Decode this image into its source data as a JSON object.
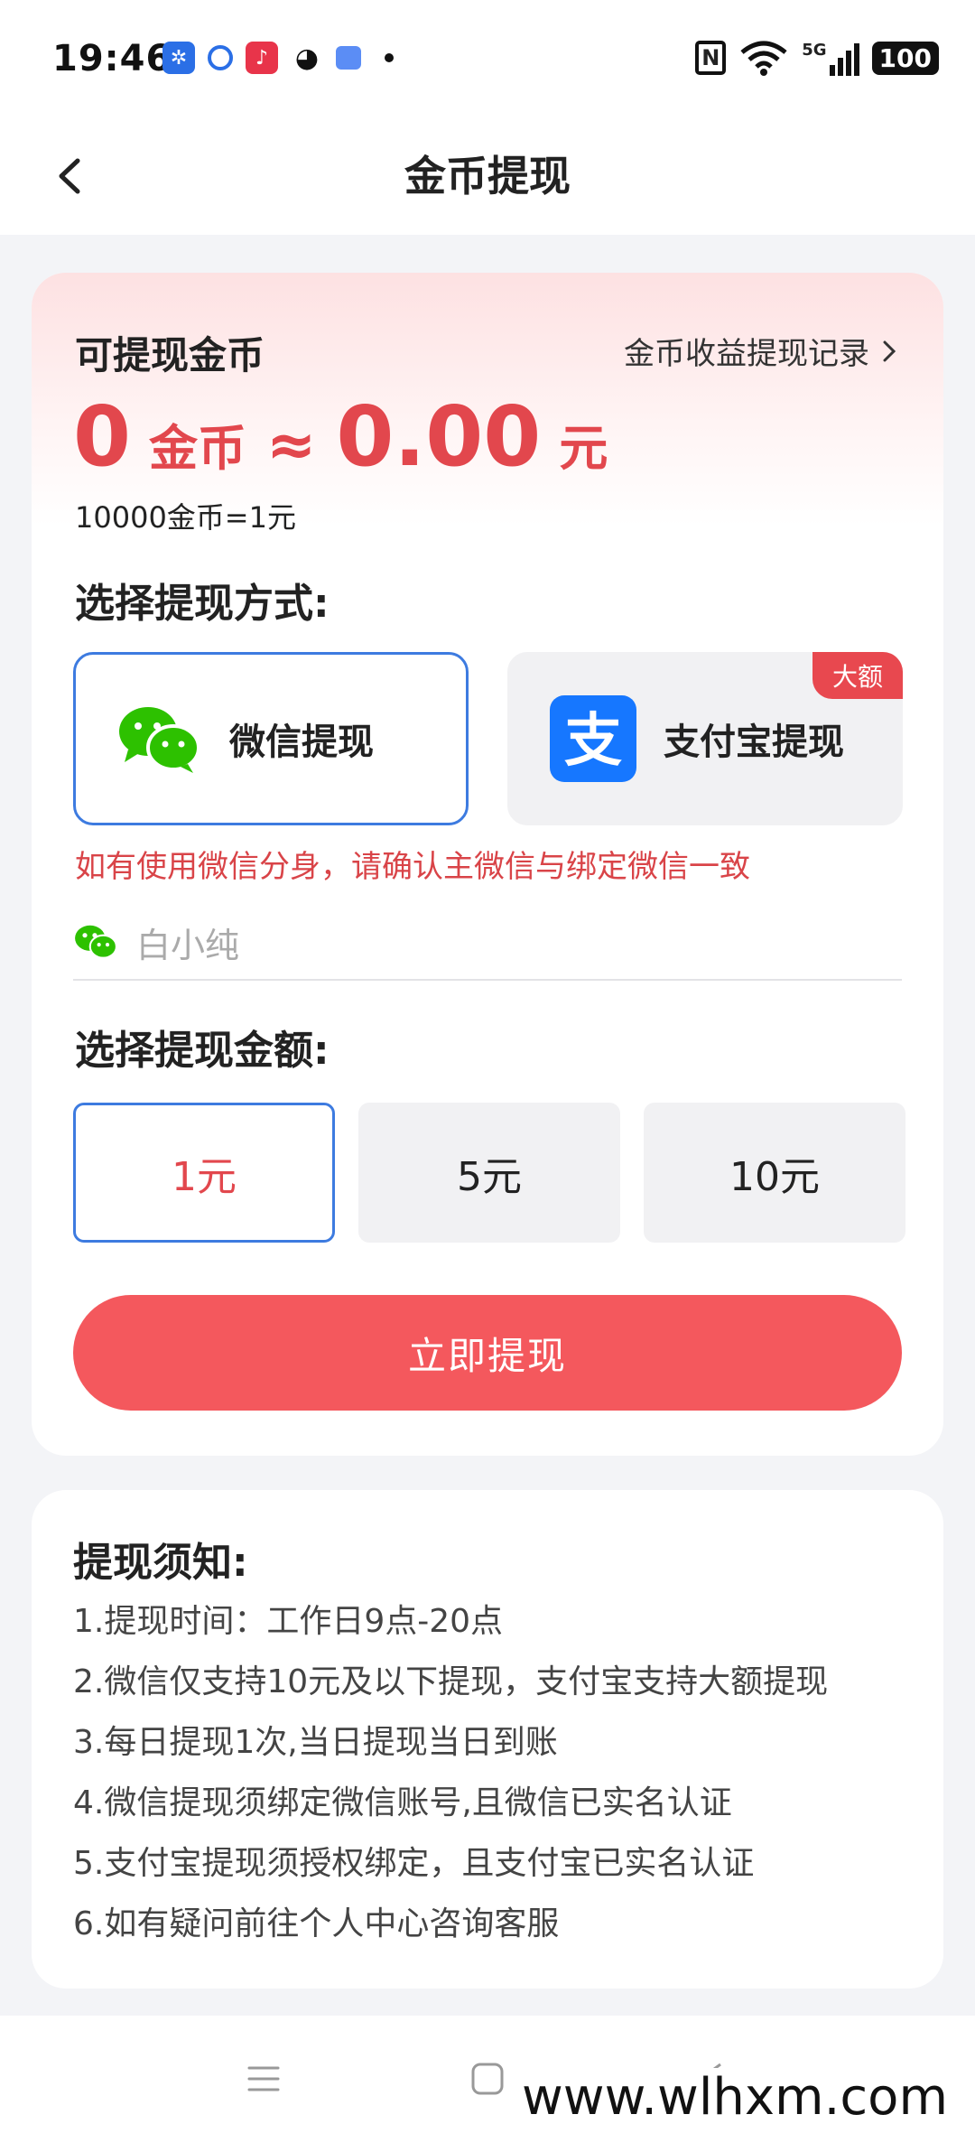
{
  "status_bar": {
    "time": "19:46",
    "network": "5G",
    "battery": "100"
  },
  "header": {
    "title": "金币提现"
  },
  "balance": {
    "label": "可提现金币",
    "records_link": "金币收益提现记录",
    "coins": "0",
    "coin_unit": "金币",
    "approx": "≈",
    "yuan": "0.00",
    "yuan_unit": "元",
    "rate": "10000金币=1元"
  },
  "method_section": {
    "title": "选择提现方式:",
    "wechat_label": "微信提现",
    "alipay_label": "支付宝提现",
    "alipay_badge": "大额",
    "selected": "wechat"
  },
  "wechat_notice": "如有使用微信分身，请确认主微信与绑定微信一致",
  "account": {
    "name": "白小纯"
  },
  "amount_section": {
    "title": "选择提现金额:",
    "options": [
      "1元",
      "5元",
      "10元"
    ],
    "selected_index": 0
  },
  "submit_label": "立即提现",
  "rules": {
    "title": "提现须知:",
    "items": [
      "1.提现时间：工作日9点-20点",
      "2.微信仅支持10元及以下提现，支付宝支持大额提现",
      "3.每日提现1次,当日提现当日到账",
      "4.微信提现须绑定微信账号,且微信已实名认证",
      "5.支付宝提现须授权绑定，且支付宝已实名认证",
      "6.如有疑问前往个人中心咨询客服"
    ]
  },
  "watermark": "www.wlhxm.com",
  "colors": {
    "accent_red": "#e2474d",
    "button_red": "#f4585d",
    "select_blue": "#3d7be0",
    "wechat_green": "#2dc100",
    "alipay_blue": "#1677ff"
  }
}
